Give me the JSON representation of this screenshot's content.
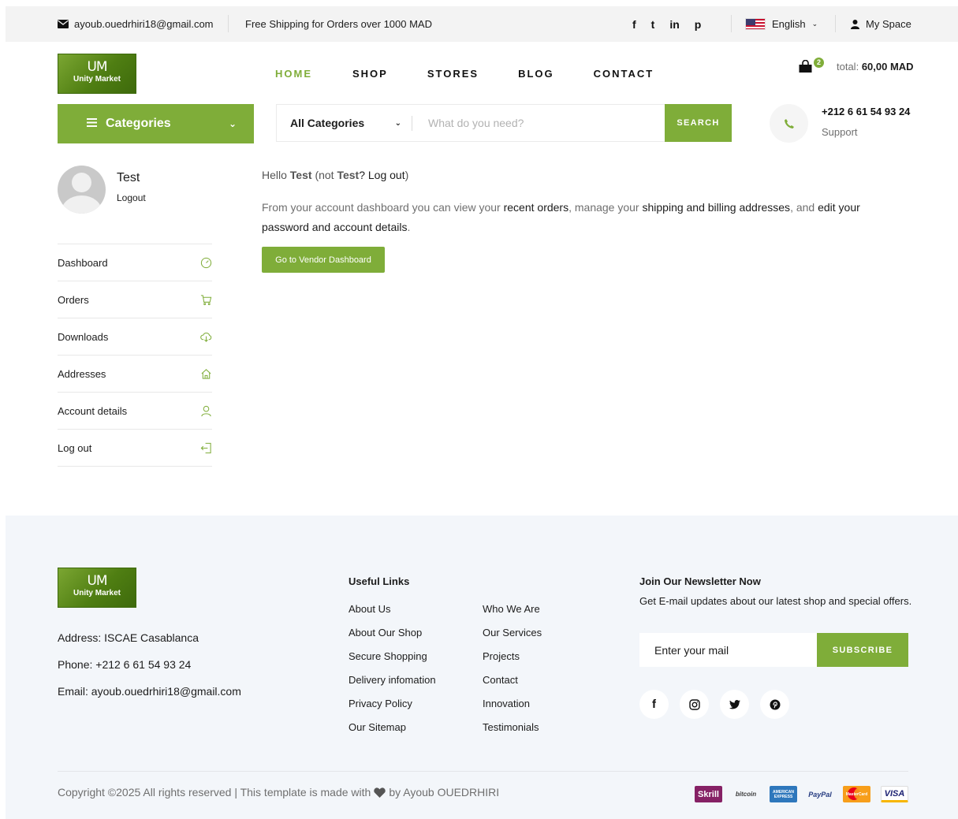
{
  "topbar": {
    "email": "ayoub.ouedrhiri18@gmail.com",
    "shipping": "Free Shipping for Orders over 1000 MAD",
    "social": [
      "f",
      "t",
      "in",
      "p"
    ],
    "language": "English",
    "account": "My Space"
  },
  "header": {
    "logo_mark": "UM",
    "logo_name": "Unity Market",
    "nav": [
      "HOME",
      "SHOP",
      "STORES",
      "BLOG",
      "CONTACT"
    ],
    "cart_count": "2",
    "total_label": "total:",
    "total_value": "60,00 MAD"
  },
  "search": {
    "categories_button": "Categories",
    "all_categories": "All Categories",
    "placeholder": "What do you need?",
    "button": "SEARCH"
  },
  "support": {
    "phone": "+212 6 61 54 93 24",
    "label": "Support"
  },
  "account": {
    "username": "Test",
    "logout": "Logout",
    "menu": [
      "Dashboard",
      "Orders",
      "Downloads",
      "Addresses",
      "Account details",
      "Log out"
    ]
  },
  "content": {
    "hello": "Hello",
    "user": "Test",
    "not": "(not",
    "user2": "Test",
    "logout_link": "? Log out",
    "close_paren": ")",
    "desc_1": "From your account dashboard you can view your ",
    "link_orders": "recent orders",
    "desc_2": ", manage your ",
    "link_addresses": "shipping and billing addresses",
    "desc_3": ", and ",
    "link_edit": "edit your password and account details",
    "desc_4": ".",
    "vendor_button": "Go to Vendor Dashboard"
  },
  "footer": {
    "address": "Address: ISCAE Casablanca",
    "phone": "Phone: +212 6 61 54 93 24",
    "email": "Email: ayoub.ouedrhiri18@gmail.com",
    "useful_title": "Useful Links",
    "links_col1": [
      "About Us",
      "About Our Shop",
      "Secure Shopping",
      "Delivery infomation",
      "Privacy Policy",
      "Our Sitemap"
    ],
    "links_col2": [
      "Who We Are",
      "Our Services",
      "Projects",
      "Contact",
      "Innovation",
      "Testimonials"
    ],
    "newsletter_title": "Join Our Newsletter Now",
    "newsletter_text": "Get E-mail updates about our latest shop and special offers.",
    "newsletter_placeholder": "Enter your mail",
    "subscribe": "SUBSCRIBE",
    "copyright_1": "Copyright ©2025 All rights reserved | This template is made with",
    "copyright_2": "by Ayoub OUEDRHIRI",
    "payments": [
      "Skrill",
      "bitcoin",
      "AMERICAN EXPRESS",
      "PayPal",
      "MasterCard",
      "VISA"
    ]
  },
  "colors": {
    "accent": "#7fad39",
    "topbar_bg": "#f3f3f3",
    "footer_bg": "#f3f6fa"
  }
}
